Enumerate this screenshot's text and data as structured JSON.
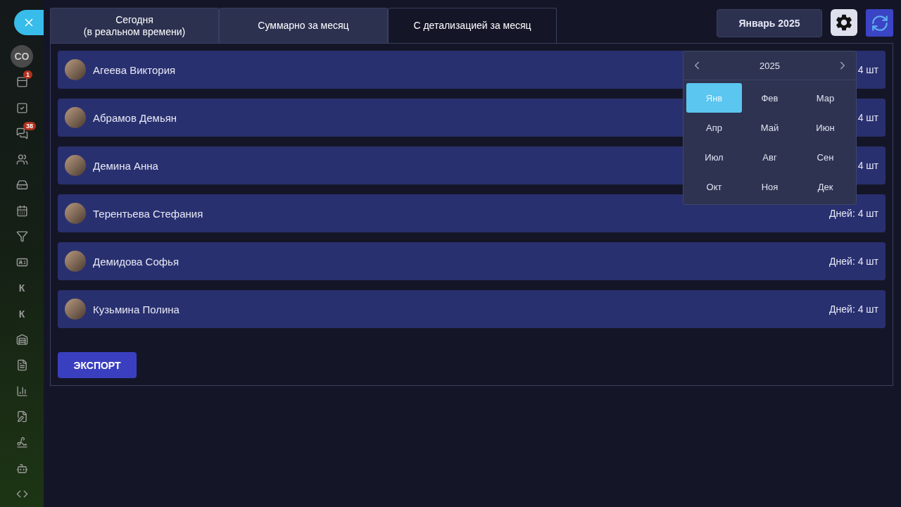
{
  "sidebar": {
    "items": [
      {
        "kind": "avatar",
        "text": "CO"
      },
      {
        "kind": "icon",
        "badge": "1"
      },
      {
        "kind": "icon"
      },
      {
        "kind": "icon",
        "badge": "38"
      },
      {
        "kind": "icon"
      },
      {
        "kind": "icon"
      },
      {
        "kind": "icon"
      },
      {
        "kind": "icon"
      },
      {
        "kind": "icon"
      },
      {
        "kind": "letter",
        "text": "К"
      },
      {
        "kind": "letter",
        "text": "К"
      },
      {
        "kind": "icon"
      },
      {
        "kind": "icon"
      },
      {
        "kind": "icon"
      },
      {
        "kind": "icon"
      },
      {
        "kind": "icon"
      },
      {
        "kind": "icon"
      },
      {
        "kind": "icon"
      }
    ]
  },
  "tabs": [
    {
      "label": "Сегодня\n(в реальном времени)",
      "selected": false
    },
    {
      "label": "Суммарно за месяц",
      "selected": false
    },
    {
      "label": "С детализацией за месяц",
      "selected": true
    }
  ],
  "month_button": "Январь 2025",
  "rows": [
    {
      "name": "Агеева Виктория",
      "days": "4 шт"
    },
    {
      "name": "Абрамов Демьян",
      "days": "4 шт"
    },
    {
      "name": "Демина Анна",
      "days": "4 шт"
    },
    {
      "name": "Терентьева Стефания",
      "days": "Дней: 4 шт"
    },
    {
      "name": "Демидова Софья",
      "days": "Дней: 4 шт"
    },
    {
      "name": "Кузьмина Полина",
      "days": "Дней: 4 шт"
    }
  ],
  "export_button": "ЭКСПОРТ",
  "month_picker": {
    "year": "2025",
    "months": [
      {
        "label": "Янв",
        "selected": true
      },
      {
        "label": "Фев",
        "selected": false
      },
      {
        "label": "Мар",
        "selected": false
      },
      {
        "label": "Апр",
        "selected": false
      },
      {
        "label": "Май",
        "selected": false
      },
      {
        "label": "Июн",
        "selected": false
      },
      {
        "label": "Июл",
        "selected": false
      },
      {
        "label": "Авг",
        "selected": false
      },
      {
        "label": "Сен",
        "selected": false
      },
      {
        "label": "Окт",
        "selected": false
      },
      {
        "label": "Ноя",
        "selected": false
      },
      {
        "label": "Дек",
        "selected": false
      }
    ]
  }
}
